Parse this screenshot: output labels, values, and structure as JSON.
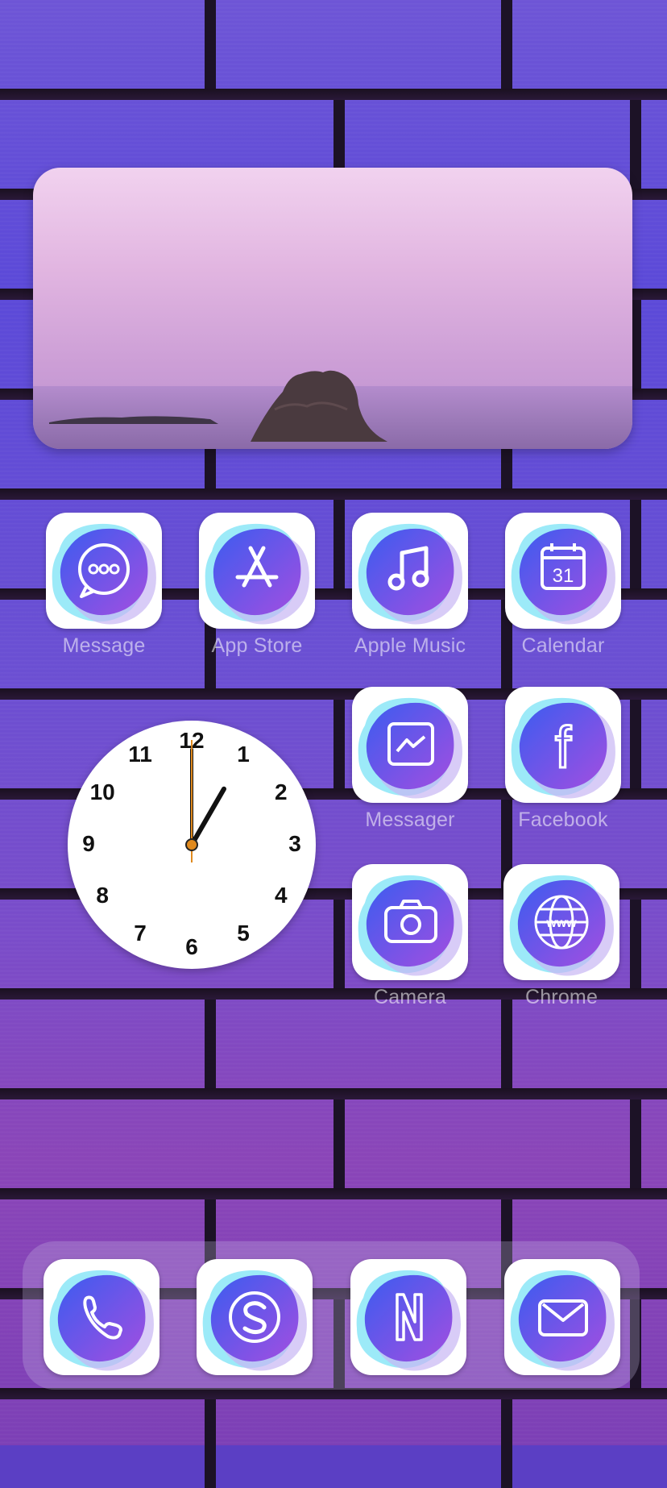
{
  "wallpaper": {
    "type": "purple-brick-wall"
  },
  "photo_widget": {
    "subject": "pink-sky-sea-rock"
  },
  "apps": [
    {
      "label": "Message",
      "icon": "message-bubble-icon"
    },
    {
      "label": "App Store",
      "icon": "app-store-icon"
    },
    {
      "label": "Apple Music",
      "icon": "music-note-icon"
    },
    {
      "label": "Calendar",
      "icon": "calendar-icon",
      "date": "31"
    },
    {
      "label": "Messager",
      "icon": "messenger-icon"
    },
    {
      "label": "Facebook",
      "icon": "facebook-icon",
      "glyph": "f"
    },
    {
      "label": "Camera",
      "icon": "camera-icon"
    },
    {
      "label": "Chrome",
      "icon": "globe-icon",
      "glyph": "www"
    }
  ],
  "clock": {
    "numbers": [
      "12",
      "1",
      "2",
      "3",
      "4",
      "5",
      "6",
      "7",
      "8",
      "9",
      "10",
      "11"
    ],
    "time": "1:00"
  },
  "dock": [
    {
      "name": "phone",
      "icon": "phone-icon"
    },
    {
      "name": "skype",
      "icon": "skype-icon"
    },
    {
      "name": "netflix",
      "icon": "netflix-icon"
    },
    {
      "name": "gmail",
      "icon": "gmail-icon"
    }
  ],
  "colors": {
    "icon_gradient_start": "#3b5cf0",
    "icon_gradient_end": "#a34ee0",
    "icon_accent_cyan": "#4ad8f2",
    "clock_second_hand": "#e08a1e"
  }
}
